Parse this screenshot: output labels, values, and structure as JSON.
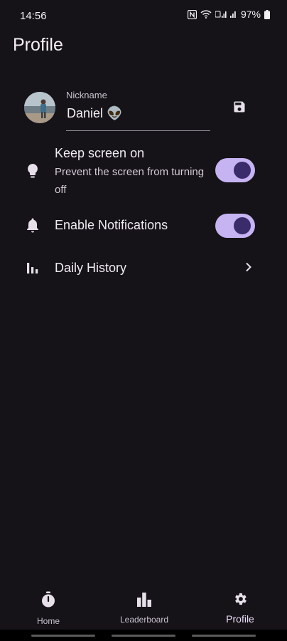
{
  "status_bar": {
    "time": "14:56",
    "battery": "97%"
  },
  "page": {
    "title": "Profile"
  },
  "profile": {
    "nickname_label": "Nickname",
    "nickname_value": "Daniel 👽"
  },
  "settings": [
    {
      "title": "Keep screen on",
      "subtitle": "Prevent the screen from turning off",
      "icon": "lightbulb-icon",
      "toggle_on": true
    },
    {
      "title": "Enable Notifications",
      "icon": "bell-icon",
      "toggle_on": true
    },
    {
      "title": "Daily History",
      "icon": "bar-chart-icon"
    }
  ],
  "bottom_nav": {
    "items": [
      {
        "label": "Home",
        "icon": "stopwatch-icon"
      },
      {
        "label": "Leaderboard",
        "icon": "leaderboard-icon"
      },
      {
        "label": "Profile",
        "icon": "gear-icon",
        "active": true
      }
    ]
  },
  "colors": {
    "background": "#151218",
    "toggle_track": "#c6b3f2",
    "toggle_thumb": "#3a2b6a"
  }
}
